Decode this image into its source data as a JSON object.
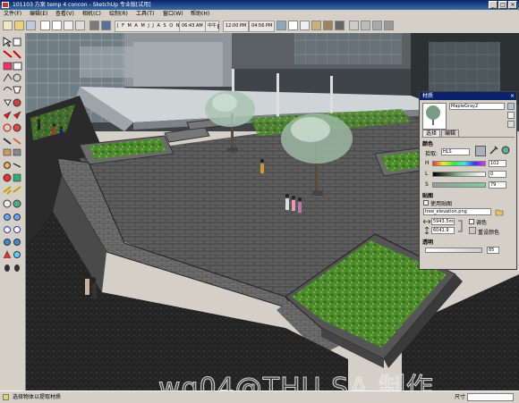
{
  "window": {
    "title": "101103 方案 temp 4 concon - SketchUp 专业版[试用]",
    "minimize": "_",
    "maximize": "□",
    "close": "×"
  },
  "menubar": {
    "items": [
      "文件(F)",
      "编辑(E)",
      "查看(V)",
      "相机(C)",
      "绘制(R)",
      "工具(T)",
      "窗口(W)",
      "帮助(H)"
    ]
  },
  "toolbar": {
    "months": "J F M A M J J A S O N D",
    "time_left": "06:43 AM",
    "time_mid": "中午",
    "time_right": "12:00 PM",
    "time_end": "04:56 PM"
  },
  "material_panel": {
    "title": "材质",
    "material_name": "MapleGray2",
    "tabs": [
      "选择",
      "编辑"
    ],
    "color_section": "颜色",
    "picker_label": "拾取:",
    "picker_value": "HLS",
    "h_label": "H",
    "l_label": "L",
    "s_label": "S",
    "h_value": "102",
    "l_value": "0",
    "s_value": "79",
    "texture_section": "贴图",
    "use_texture": "使用贴图",
    "texture_file": "tree_elevation.png",
    "width_value": "5943.5mm",
    "height_value": "6041.9",
    "colorize_label": "调色",
    "reset_color": "重设颜色",
    "opacity_section": "透明",
    "opacity_value": "85"
  },
  "statusbar": {
    "hint": "选择物体以提取材质",
    "measure_label": "尺寸"
  },
  "watermark": "wg04@THU SA 制作",
  "colors": {
    "titlebar": "#0a246a",
    "grass": "#4e8a2e",
    "paving": "#5a5a5a",
    "panel_bg": "#d4d0c8"
  }
}
